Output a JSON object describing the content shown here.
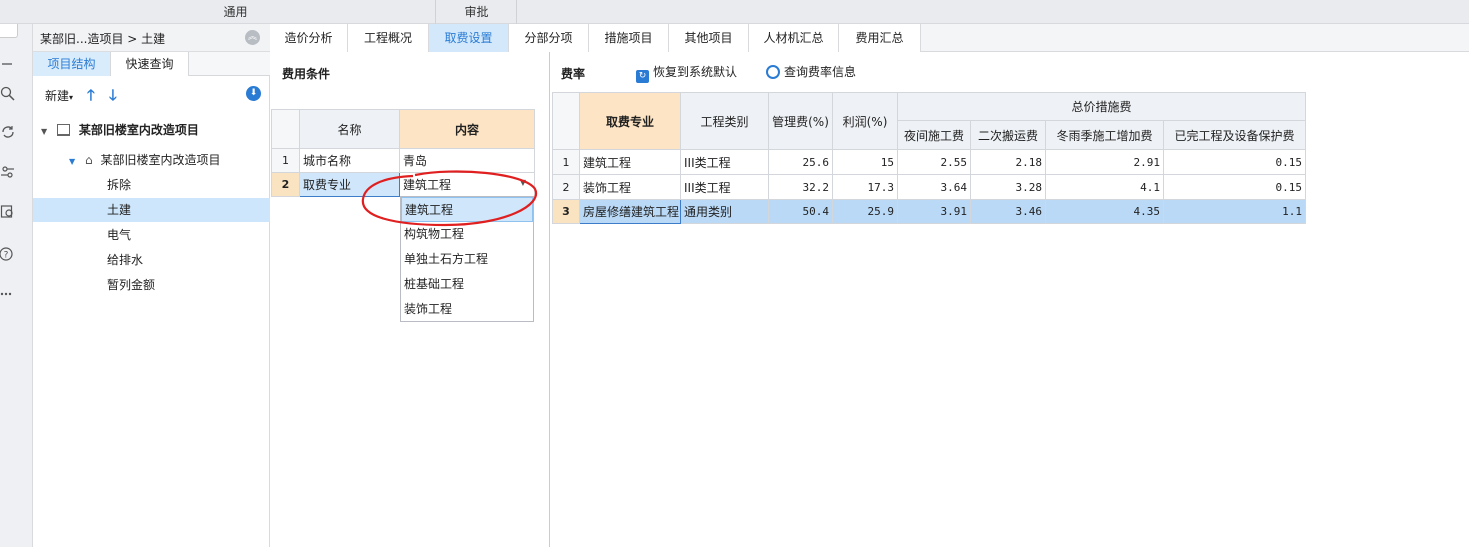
{
  "top_band": {
    "left_label": "通用",
    "right_label": "审批"
  },
  "breadcrumb": {
    "text": "某部旧...造项目 > 土建"
  },
  "tree_tabs": [
    "项目结构",
    "快速查询"
  ],
  "tree_toolbar": {
    "new_label": "新建"
  },
  "tree": {
    "root": "某部旧楼室内改造项目",
    "project": "某部旧楼室内改造项目",
    "items": [
      "拆除",
      "土建",
      "电气",
      "给排水",
      "暂列金额"
    ],
    "selected": "土建"
  },
  "main_tabs": [
    "造价分析",
    "工程概况",
    "取费设置",
    "分部分项",
    "措施项目",
    "其他项目",
    "人材机汇总",
    "费用汇总"
  ],
  "active_tab": "取费设置",
  "condition": {
    "title": "费用条件",
    "headers": [
      "名称",
      "内容"
    ],
    "rows": [
      {
        "num": "1",
        "name": "城市名称",
        "value": "青岛"
      },
      {
        "num": "2",
        "name": "取费专业",
        "value": "建筑工程"
      }
    ],
    "dropdown_options": [
      "建筑工程",
      "构筑物工程",
      "单独土石方工程",
      "桩基础工程",
      "装饰工程"
    ],
    "dropdown_selected": "建筑工程"
  },
  "rates": {
    "title": "费率",
    "restore_label": "恢复到系统默认",
    "query_label": "查询费率信息",
    "headers": {
      "specialty": "取费专业",
      "category": "工程类别",
      "management": "管理费(%)",
      "profit": "利润(%)",
      "group": "总价措施费",
      "night": "夜间施工费",
      "secondary": "二次搬运费",
      "winter": "冬雨季施工增加费",
      "protection": "已完工程及设备保护费"
    },
    "rows": [
      {
        "num": "1",
        "specialty": "建筑工程",
        "category": "III类工程",
        "management": "25.6",
        "profit": "15",
        "night": "2.55",
        "secondary": "2.18",
        "winter": "2.91",
        "protection": "0.15"
      },
      {
        "num": "2",
        "specialty": "装饰工程",
        "category": "III类工程",
        "management": "32.2",
        "profit": "17.3",
        "night": "3.64",
        "secondary": "3.28",
        "winter": "4.1",
        "protection": "0.15"
      },
      {
        "num": "3",
        "specialty": "房屋修缮建筑工程",
        "category": "通用类别",
        "management": "50.4",
        "profit": "25.9",
        "night": "3.91",
        "secondary": "3.46",
        "winter": "4.35",
        "protection": "1.1"
      }
    ]
  },
  "colors": {
    "accent": "#2a7bd4",
    "selection": "#b9d9f7",
    "header_orange": "#fde4c4",
    "annotation_red": "#e02020"
  }
}
